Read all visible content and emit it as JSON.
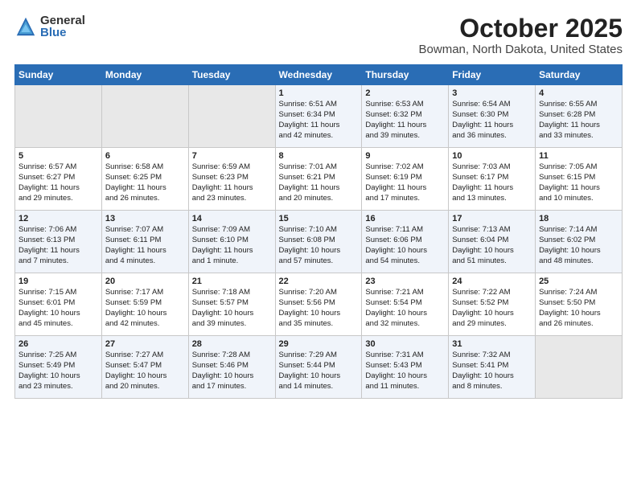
{
  "header": {
    "logo_general": "General",
    "logo_blue": "Blue",
    "title": "October 2025",
    "subtitle": "Bowman, North Dakota, United States"
  },
  "calendar": {
    "days_of_week": [
      "Sunday",
      "Monday",
      "Tuesday",
      "Wednesday",
      "Thursday",
      "Friday",
      "Saturday"
    ],
    "weeks": [
      [
        {
          "day": "",
          "info": ""
        },
        {
          "day": "",
          "info": ""
        },
        {
          "day": "",
          "info": ""
        },
        {
          "day": "1",
          "info": "Sunrise: 6:51 AM\nSunset: 6:34 PM\nDaylight: 11 hours\nand 42 minutes."
        },
        {
          "day": "2",
          "info": "Sunrise: 6:53 AM\nSunset: 6:32 PM\nDaylight: 11 hours\nand 39 minutes."
        },
        {
          "day": "3",
          "info": "Sunrise: 6:54 AM\nSunset: 6:30 PM\nDaylight: 11 hours\nand 36 minutes."
        },
        {
          "day": "4",
          "info": "Sunrise: 6:55 AM\nSunset: 6:28 PM\nDaylight: 11 hours\nand 33 minutes."
        }
      ],
      [
        {
          "day": "5",
          "info": "Sunrise: 6:57 AM\nSunset: 6:27 PM\nDaylight: 11 hours\nand 29 minutes."
        },
        {
          "day": "6",
          "info": "Sunrise: 6:58 AM\nSunset: 6:25 PM\nDaylight: 11 hours\nand 26 minutes."
        },
        {
          "day": "7",
          "info": "Sunrise: 6:59 AM\nSunset: 6:23 PM\nDaylight: 11 hours\nand 23 minutes."
        },
        {
          "day": "8",
          "info": "Sunrise: 7:01 AM\nSunset: 6:21 PM\nDaylight: 11 hours\nand 20 minutes."
        },
        {
          "day": "9",
          "info": "Sunrise: 7:02 AM\nSunset: 6:19 PM\nDaylight: 11 hours\nand 17 minutes."
        },
        {
          "day": "10",
          "info": "Sunrise: 7:03 AM\nSunset: 6:17 PM\nDaylight: 11 hours\nand 13 minutes."
        },
        {
          "day": "11",
          "info": "Sunrise: 7:05 AM\nSunset: 6:15 PM\nDaylight: 11 hours\nand 10 minutes."
        }
      ],
      [
        {
          "day": "12",
          "info": "Sunrise: 7:06 AM\nSunset: 6:13 PM\nDaylight: 11 hours\nand 7 minutes."
        },
        {
          "day": "13",
          "info": "Sunrise: 7:07 AM\nSunset: 6:11 PM\nDaylight: 11 hours\nand 4 minutes."
        },
        {
          "day": "14",
          "info": "Sunrise: 7:09 AM\nSunset: 6:10 PM\nDaylight: 11 hours\nand 1 minute."
        },
        {
          "day": "15",
          "info": "Sunrise: 7:10 AM\nSunset: 6:08 PM\nDaylight: 10 hours\nand 57 minutes."
        },
        {
          "day": "16",
          "info": "Sunrise: 7:11 AM\nSunset: 6:06 PM\nDaylight: 10 hours\nand 54 minutes."
        },
        {
          "day": "17",
          "info": "Sunrise: 7:13 AM\nSunset: 6:04 PM\nDaylight: 10 hours\nand 51 minutes."
        },
        {
          "day": "18",
          "info": "Sunrise: 7:14 AM\nSunset: 6:02 PM\nDaylight: 10 hours\nand 48 minutes."
        }
      ],
      [
        {
          "day": "19",
          "info": "Sunrise: 7:15 AM\nSunset: 6:01 PM\nDaylight: 10 hours\nand 45 minutes."
        },
        {
          "day": "20",
          "info": "Sunrise: 7:17 AM\nSunset: 5:59 PM\nDaylight: 10 hours\nand 42 minutes."
        },
        {
          "day": "21",
          "info": "Sunrise: 7:18 AM\nSunset: 5:57 PM\nDaylight: 10 hours\nand 39 minutes."
        },
        {
          "day": "22",
          "info": "Sunrise: 7:20 AM\nSunset: 5:56 PM\nDaylight: 10 hours\nand 35 minutes."
        },
        {
          "day": "23",
          "info": "Sunrise: 7:21 AM\nSunset: 5:54 PM\nDaylight: 10 hours\nand 32 minutes."
        },
        {
          "day": "24",
          "info": "Sunrise: 7:22 AM\nSunset: 5:52 PM\nDaylight: 10 hours\nand 29 minutes."
        },
        {
          "day": "25",
          "info": "Sunrise: 7:24 AM\nSunset: 5:50 PM\nDaylight: 10 hours\nand 26 minutes."
        }
      ],
      [
        {
          "day": "26",
          "info": "Sunrise: 7:25 AM\nSunset: 5:49 PM\nDaylight: 10 hours\nand 23 minutes."
        },
        {
          "day": "27",
          "info": "Sunrise: 7:27 AM\nSunset: 5:47 PM\nDaylight: 10 hours\nand 20 minutes."
        },
        {
          "day": "28",
          "info": "Sunrise: 7:28 AM\nSunset: 5:46 PM\nDaylight: 10 hours\nand 17 minutes."
        },
        {
          "day": "29",
          "info": "Sunrise: 7:29 AM\nSunset: 5:44 PM\nDaylight: 10 hours\nand 14 minutes."
        },
        {
          "day": "30",
          "info": "Sunrise: 7:31 AM\nSunset: 5:43 PM\nDaylight: 10 hours\nand 11 minutes."
        },
        {
          "day": "31",
          "info": "Sunrise: 7:32 AM\nSunset: 5:41 PM\nDaylight: 10 hours\nand 8 minutes."
        },
        {
          "day": "",
          "info": ""
        }
      ]
    ]
  }
}
